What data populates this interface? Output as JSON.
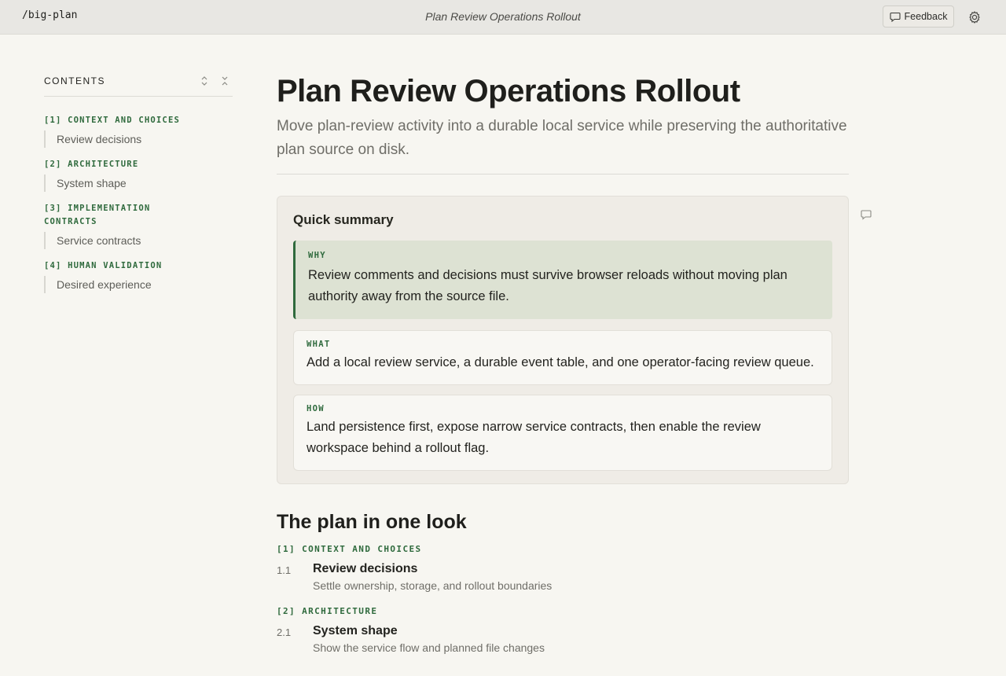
{
  "topbar": {
    "brand": "/big-plan",
    "doc_title": "Plan Review Operations Rollout",
    "feedback_label": "Feedback"
  },
  "toc": {
    "title": "CONTENTS",
    "sections": [
      {
        "label": "[1] CONTEXT AND CHOICES",
        "items": [
          "Review decisions"
        ]
      },
      {
        "label": "[2] ARCHITECTURE",
        "items": [
          "System shape"
        ]
      },
      {
        "label": "[3] IMPLEMENTATION CONTRACTS",
        "items": [
          "Service contracts"
        ]
      },
      {
        "label": "[4] HUMAN VALIDATION",
        "items": [
          "Desired experience"
        ]
      }
    ]
  },
  "main": {
    "title": "Plan Review Operations Rollout",
    "subtitle": "Move plan-review activity into a durable local service while preserving the authoritative plan source on disk.",
    "summary": {
      "title": "Quick summary",
      "why": {
        "kicker": "WHY",
        "text": "Review comments and decisions must survive browser reloads without moving plan authority away from the source file."
      },
      "what": {
        "kicker": "WHAT",
        "text": "Add a local review service, a durable event table, and one operator-facing review queue."
      },
      "how": {
        "kicker": "HOW",
        "text": "Land persistence first, expose narrow service contracts, then enable the review workspace behind a rollout flag."
      }
    },
    "look": {
      "title": "The plan in one look",
      "sections": [
        {
          "label": "[1] CONTEXT AND CHOICES",
          "num": "1.1",
          "name": "Review decisions",
          "desc": "Settle ownership, storage, and rollout boundaries"
        },
        {
          "label": "[2] ARCHITECTURE",
          "num": "2.1",
          "name": "System shape",
          "desc": "Show the service flow and planned file changes"
        }
      ]
    }
  },
  "colors": {
    "accent": "#2f6a3d",
    "background": "#f7f6f1",
    "topbar": "#e8e7e3"
  },
  "icons": {
    "feedback": "speech-bubble-icon",
    "settings": "gear-icon",
    "expand": "chevrons-expand-icon",
    "collapse": "chevrons-collapse-icon",
    "comment": "comment-icon"
  }
}
